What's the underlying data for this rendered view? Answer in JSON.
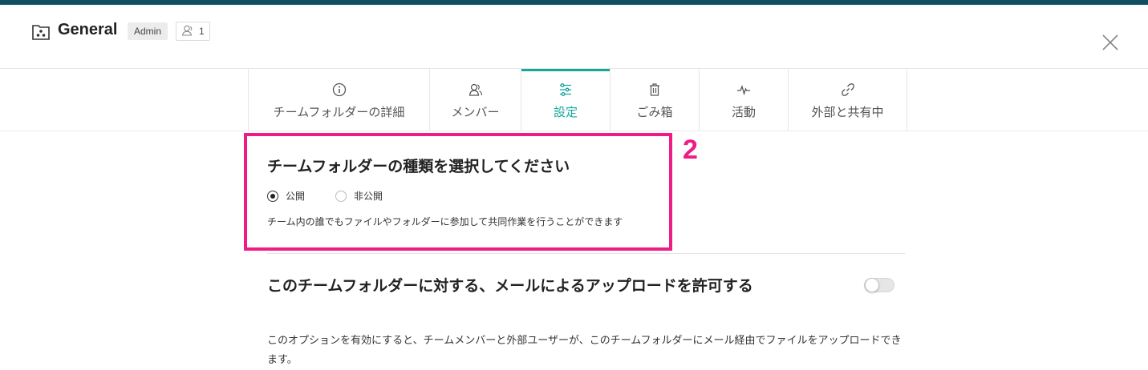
{
  "colors": {
    "topbar": "#0f4f5f",
    "accent": "#13a89e",
    "highlight": "#ee1c84"
  },
  "header": {
    "folder_icon": "team-folder-icon",
    "title": "General",
    "role_badge": "Admin",
    "member_icon": "person-icon",
    "member_count": "1",
    "close_icon": "close-icon"
  },
  "tabs": [
    {
      "label": "チームフォルダーの詳細",
      "icon": "info-icon",
      "active": false
    },
    {
      "label": "メンバー",
      "icon": "members-icon",
      "active": false
    },
    {
      "label": "設定",
      "icon": "settings-sliders-icon",
      "active": true
    },
    {
      "label": "ごみ箱",
      "icon": "trash-icon",
      "active": false
    },
    {
      "label": "活動",
      "icon": "activity-pulse-icon",
      "active": false
    },
    {
      "label": "外部と共有中",
      "icon": "link-icon",
      "active": false
    }
  ],
  "annotation": {
    "step_number": "2"
  },
  "folder_type": {
    "title": "チームフォルダーの種類を選択してください",
    "options": [
      {
        "label": "公開",
        "checked": true
      },
      {
        "label": "非公開",
        "checked": false
      }
    ],
    "description": "チーム内の誰でもファイルやフォルダーに参加して共同作業を行うことができます"
  },
  "email_upload": {
    "title": "このチームフォルダーに対する、メールによるアップロードを許可する",
    "enabled": false,
    "description": "このオプションを有効にすると、チームメンバーと外部ユーザーが、このチームフォルダーにメール経由でファイルをアップロードできます。"
  }
}
